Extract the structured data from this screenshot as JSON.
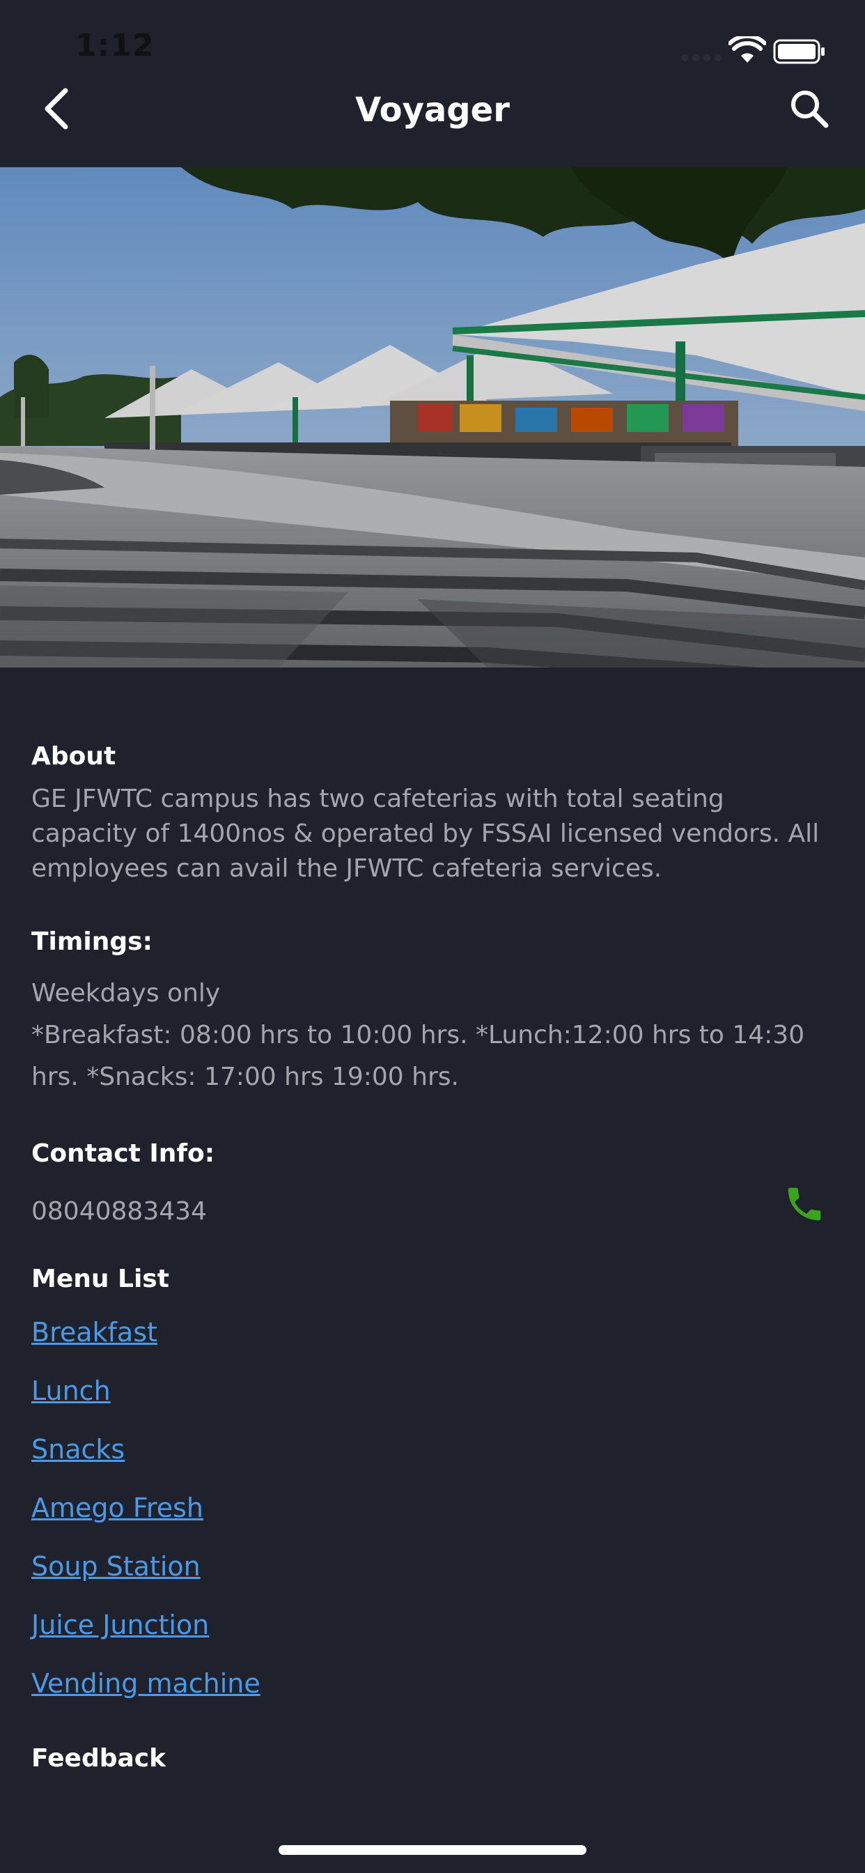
{
  "status": {
    "time": "1:12"
  },
  "nav": {
    "title": "Voyager",
    "back_icon": "chevron-left-icon",
    "search_icon": "search-icon"
  },
  "hero": {
    "description_icon": "cafeteria-photo"
  },
  "about": {
    "heading": "About",
    "text": "GE JFWTC campus has two cafeterias with total seating capacity of 1400nos &  operated by FSSAI licensed vendors. All employees can avail the JFWTC cafeteria services."
  },
  "timings": {
    "heading": "Timings:",
    "text": "Weekdays only\n*Breakfast: 08:00 hrs to 10:00 hrs. *Lunch:12:00 hrs to 14:30 hrs. *Snacks: 17:00 hrs 19:00 hrs."
  },
  "contact": {
    "heading": "Contact Info:",
    "phone": "08040883434",
    "call_icon": "phone-icon",
    "call_color": "#3aa51a"
  },
  "menu": {
    "heading": "Menu List",
    "items": [
      {
        "label": "Breakfast"
      },
      {
        "label": "Lunch"
      },
      {
        "label": "Snacks"
      },
      {
        "label": "Amego Fresh"
      },
      {
        "label": "Soup Station"
      },
      {
        "label": "Juice Junction"
      },
      {
        "label": "Vending machine"
      }
    ],
    "link_color": "#4a9ae8"
  },
  "feedback": {
    "heading": "Feedback"
  }
}
